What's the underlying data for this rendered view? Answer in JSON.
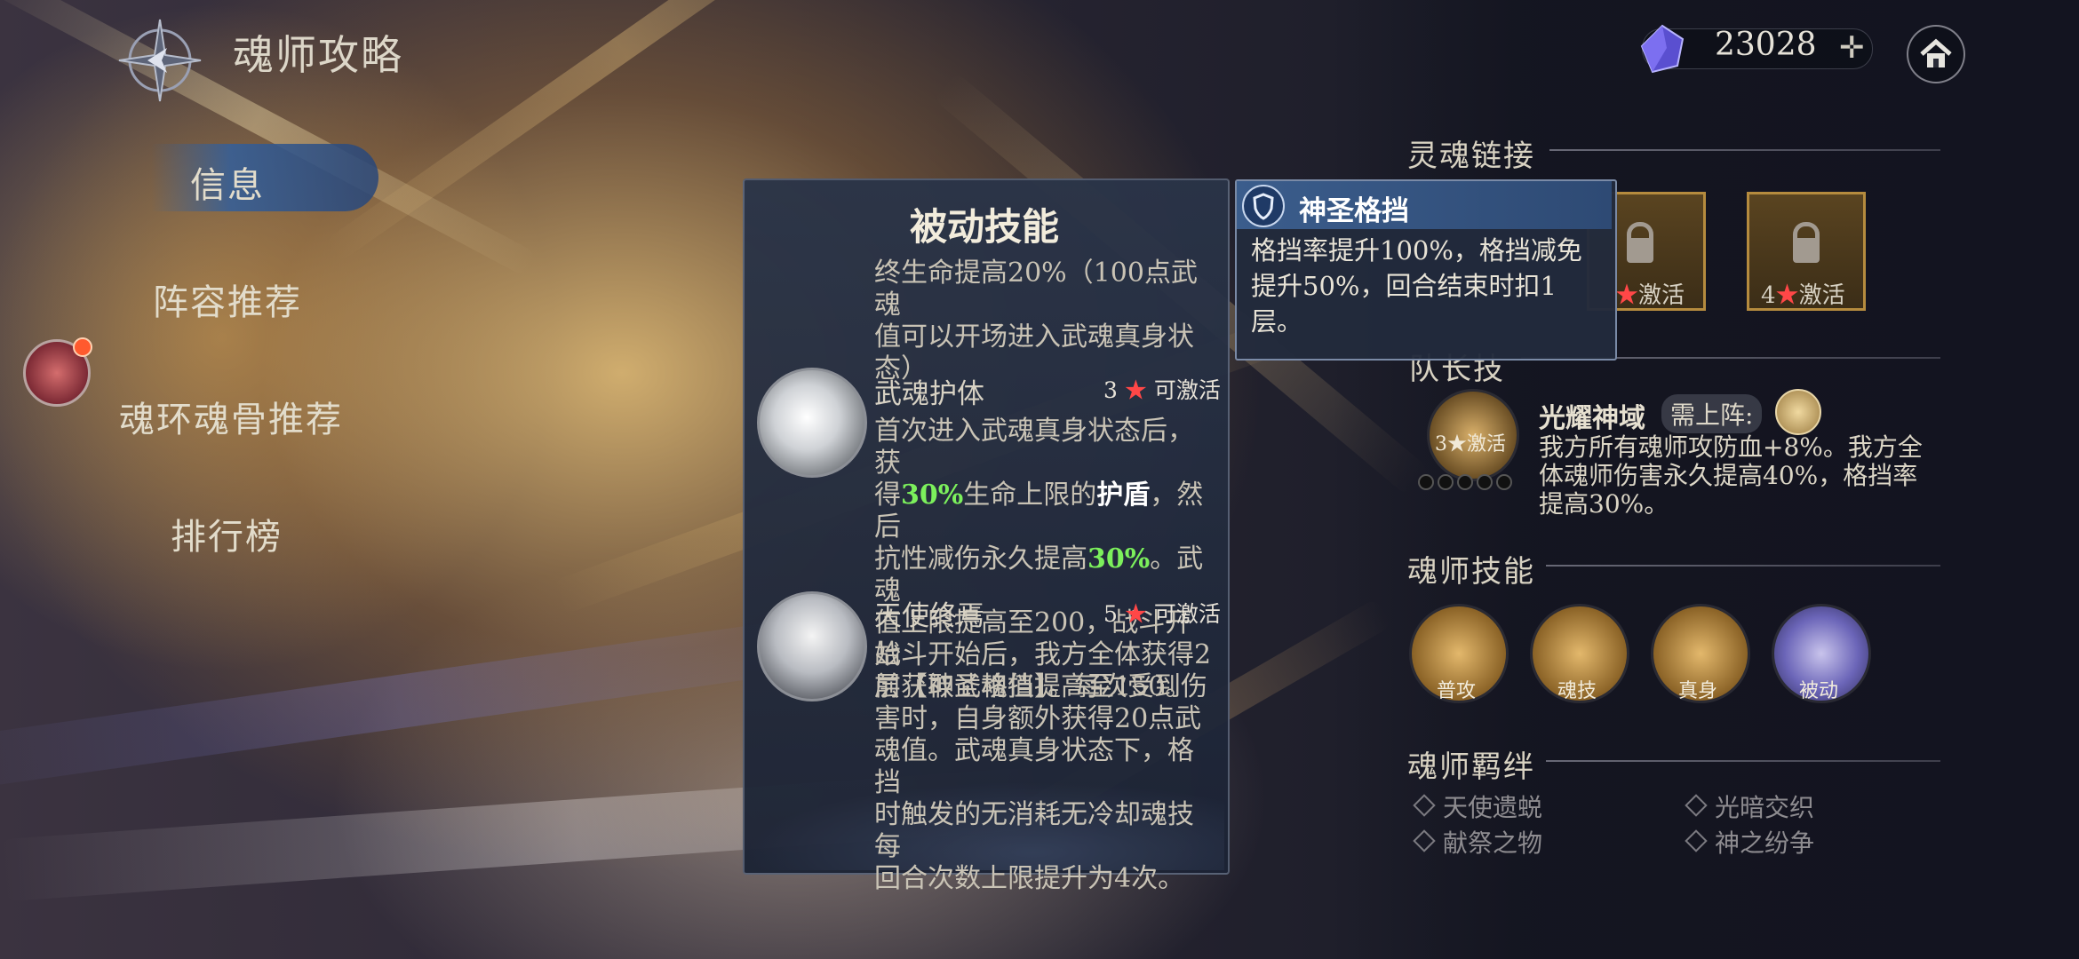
{
  "header": {
    "title": "魂师攻略",
    "currency_value": "23028",
    "currency_icon": "crystal-icon",
    "plus_icon": "plus-icon",
    "home_icon": "home-icon"
  },
  "nav": {
    "items": [
      {
        "label": "信息",
        "active": true
      },
      {
        "label": "阵容推荐"
      },
      {
        "label": "魂环魂骨推荐"
      },
      {
        "label": "排行榜"
      }
    ]
  },
  "passive_panel": {
    "title": "被动技能",
    "intro_text": "终生命提高20%（100点武魂值可以开场进入武魂真身状态）",
    "intro_lines": [
      "终生命提高20%（100点武魂",
      "值可以开场进入武魂真身状",
      "态）"
    ],
    "skills": [
      {
        "name": "武魂护体",
        "req_num": "3",
        "req_text": "可激活",
        "lines": [
          [
            "首次进入武魂真身状态后，获"
          ],
          [
            "得",
            "30%",
            "生命上限的",
            "护盾",
            "，然后"
          ],
          [
            "抗性减伤永久提高",
            "30%",
            "。武魂"
          ],
          [
            "值上限提高至200，战斗开始"
          ],
          [
            "前获取武魂值提高至150。"
          ]
        ]
      },
      {
        "name": "天使终焉",
        "req_num": "5",
        "req_text": "可激活",
        "lines": [
          "战斗开始后，我方全体获得2",
          "层【神圣格挡】。每次受到伤",
          "害时，自身额外获得20点武",
          "魂值。武魂真身状态下，格挡",
          "时触发的无消耗无冷却魂技每",
          "回合次数上限提升为4次。"
        ]
      }
    ]
  },
  "tooltip": {
    "title": "神圣格挡",
    "lines": [
      "格挡率提升100%，格挡减免",
      "提升50%，回合结束时扣1",
      "层。"
    ]
  },
  "soul_link": {
    "title": "灵魂链接",
    "slots": [
      {
        "label": "激活",
        "star": "★"
      },
      {
        "num": "4",
        "star": "★",
        "label": "激活"
      }
    ]
  },
  "leader": {
    "title_partial": "队长技",
    "badge": "3★激活",
    "name": "光耀神域",
    "req": "需上阵:",
    "lines": [
      "我方所有魂师攻防血+8%。我方全",
      "体魂师伤害永久提高40%，格挡率",
      "提高30%。"
    ]
  },
  "abilities": {
    "title": "魂师技能",
    "items": [
      "普攻",
      "魂技",
      "真身",
      "被动"
    ]
  },
  "bonds": {
    "title": "魂师羁绊",
    "items": [
      "天使遗蜕",
      "光暗交织",
      "献祭之物",
      "神之纷争"
    ]
  },
  "colors": {
    "accent_green": "#7cf05c",
    "star_red": "#ff4747",
    "gold_border": "#b58b3e",
    "tooltip_header": "#3b5d8c"
  }
}
